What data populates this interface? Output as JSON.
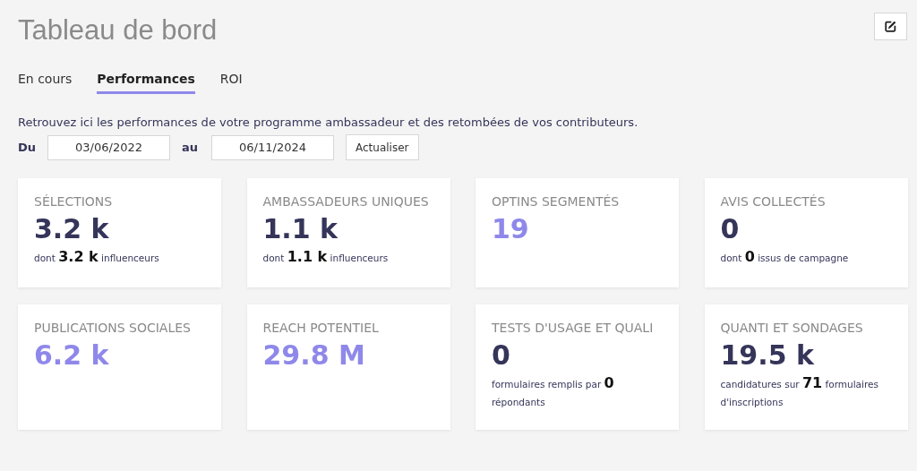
{
  "page": {
    "title": "Tableau de bord"
  },
  "tabs": [
    {
      "label": "En cours",
      "selected": false
    },
    {
      "label": "Performances",
      "selected": true
    },
    {
      "label": "ROI",
      "selected": false
    }
  ],
  "description": "Retrouvez ici les performances de votre programme ambassadeur et des retombées de vos contributeurs.",
  "date_range": {
    "from_label": "Du",
    "from_value": "03/06/2022",
    "to_label": "au",
    "to_value": "06/11/2024",
    "button": "Actualiser"
  },
  "cards": [
    {
      "title": "SÉLECTIONS",
      "value": "3.2 k",
      "color": "#35355a",
      "detail": "dont **3.2 k** influenceurs"
    },
    {
      "title": "AMBASSADEURS UNIQUES",
      "value": "1.1 k",
      "color": "#35355a",
      "detail": "dont **1.1 k** influenceurs"
    },
    {
      "title": "OPTINS SEGMENTÉS",
      "value": "19",
      "color": "#8f88ea"
    },
    {
      "title": "AVIS COLLECTÉS",
      "value": "0",
      "color": "#35355a",
      "detail": "dont **0** issus de campagne"
    },
    {
      "title": "PUBLICATIONS SOCIALES",
      "value": "6.2 k",
      "color": "#8f88ea"
    },
    {
      "title": "REACH POTENTIEL",
      "value": "29.8 M",
      "color": "#8f88ea"
    },
    {
      "title": "TESTS D'USAGE ET QUALI",
      "value": "0",
      "color": "#35355a",
      "detail": "formulaires remplis par **0** répondants"
    },
    {
      "title": "QUANTI ET SONDAGES",
      "value": "19.5 k",
      "color": "#35355a",
      "detail": "candidatures sur **71** formulaires d'inscriptions"
    }
  ]
}
